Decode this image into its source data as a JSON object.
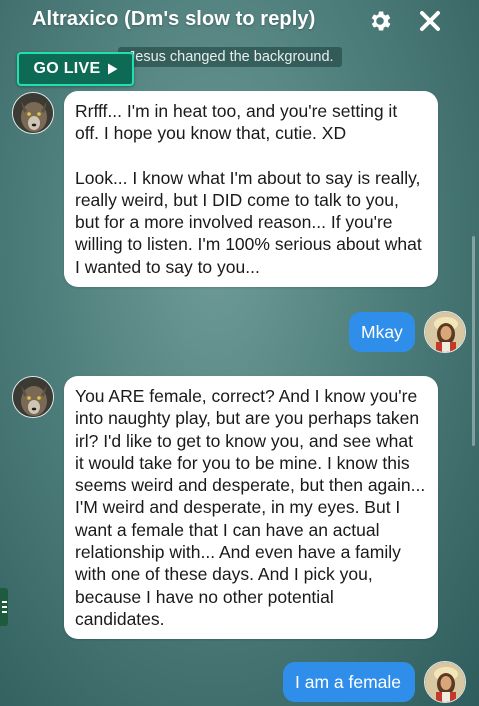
{
  "header": {
    "title": "Altraxico (Dm's slow to reply)",
    "settings_icon": "gear-icon",
    "close_icon": "close-icon"
  },
  "system_notice": "Jesus changed the background.",
  "go_live": {
    "label": "GO LIVE",
    "icon": "play-triangle-icon"
  },
  "messages": [
    {
      "sender": "other",
      "paragraphs": [
        "Rrfff... I'm in heat too, and you're setting it off. I hope you know that, cutie. XD",
        "Look... I know what I'm about to say is really, really weird, but I DID come to talk to you, but for a more involved reason... If you're willing to listen. I'm 100% serious about what I wanted to say to you..."
      ]
    },
    {
      "sender": "self",
      "text": "Mkay"
    },
    {
      "sender": "other",
      "paragraphs": [
        "You ARE female, correct? And I know you're into naughty play, but are you perhaps taken irl? I'd like to get to know you, and see what it would take for you to be mine. I know this seems weird and desperate, but then again... I'M weird and desperate, in my eyes. But I want a female that I can have an actual relationship with... And even have a family with one of these days. And I pick you, because I have no other potential candidates."
      ]
    },
    {
      "sender": "self",
      "text": "I am a female"
    }
  ],
  "colors": {
    "outgoing_bubble": "#2f8eea",
    "incoming_bubble": "#ffffff",
    "go_live_border": "#20e0b0",
    "go_live_bg": "#0d6b55"
  }
}
